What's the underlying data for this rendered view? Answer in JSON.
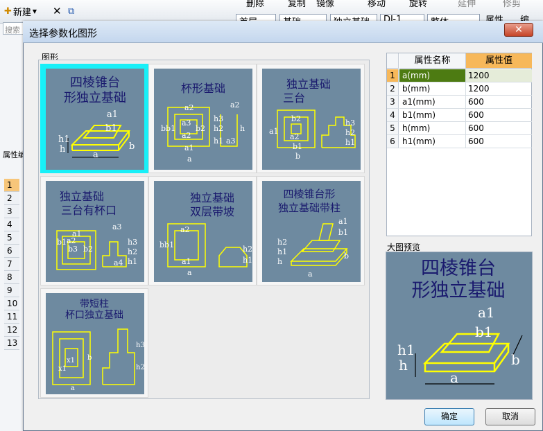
{
  "background_app": {
    "toolbar": {
      "new_label": "新建",
      "delete_label": "删除",
      "copy_label": "复制",
      "mirror_label": "镜像",
      "move_label": "移动",
      "rotate_label": "旋转",
      "extend_label": "延伸",
      "trim_label": "修剪",
      "properties_label": "属性",
      "edit_label": "编"
    },
    "filters": {
      "floor": "首层",
      "category": "基础",
      "type": "独立基础",
      "element": "DJ-1",
      "whole": "整体"
    },
    "search_placeholder": "搜索",
    "prop_panel_label": "属性编",
    "row_numbers": [
      "1",
      "2",
      "3",
      "4",
      "5",
      "6",
      "7",
      "8",
      "9",
      "10",
      "11",
      "12",
      "13"
    ]
  },
  "dialog": {
    "title": "选择参数化图形",
    "close_glyph": "✕",
    "shapes_group_label": "图形",
    "shapes": [
      {
        "line1": "四棱锥台",
        "line2": "形独立基础",
        "selected": true
      },
      {
        "line1": "杯形基础",
        "line2": "",
        "selected": false
      },
      {
        "line1": "独立基础",
        "line2": "三台",
        "selected": false
      },
      {
        "line1": "独立基础",
        "line2": "三台有杯口",
        "selected": false
      },
      {
        "line1": "独立基础",
        "line2": "双层带坡",
        "selected": false
      },
      {
        "line1": "四棱锥台形",
        "line2": "独立基础带柱",
        "selected": false
      },
      {
        "line1": "带短柱",
        "line2": "杯口独立基础",
        "selected": false
      }
    ],
    "properties_table": {
      "headers": {
        "name": "属性名称",
        "value": "属性值"
      },
      "rows": [
        {
          "num": "1",
          "name": "a(mm)",
          "value": "1200"
        },
        {
          "num": "2",
          "name": "b(mm)",
          "value": "1200"
        },
        {
          "num": "3",
          "name": "a1(mm)",
          "value": "600"
        },
        {
          "num": "4",
          "name": "b1(mm)",
          "value": "600"
        },
        {
          "num": "5",
          "name": "h(mm)",
          "value": "600"
        },
        {
          "num": "6",
          "name": "h1(mm)",
          "value": "600"
        }
      ]
    },
    "preview_label": "大图预览",
    "preview": {
      "line1": "四棱锥台",
      "line2": "形独立基础"
    },
    "ok_label": "确定",
    "cancel_label": "取消"
  },
  "colors": {
    "tile_bg": "#6e8aa0",
    "selection": "#18f0f8",
    "header_value_bg": "#f7b85a",
    "selected_row_bg": "#4d7b12",
    "drawing_stroke": "#ffff00",
    "title_text": "#1a1a6e"
  }
}
